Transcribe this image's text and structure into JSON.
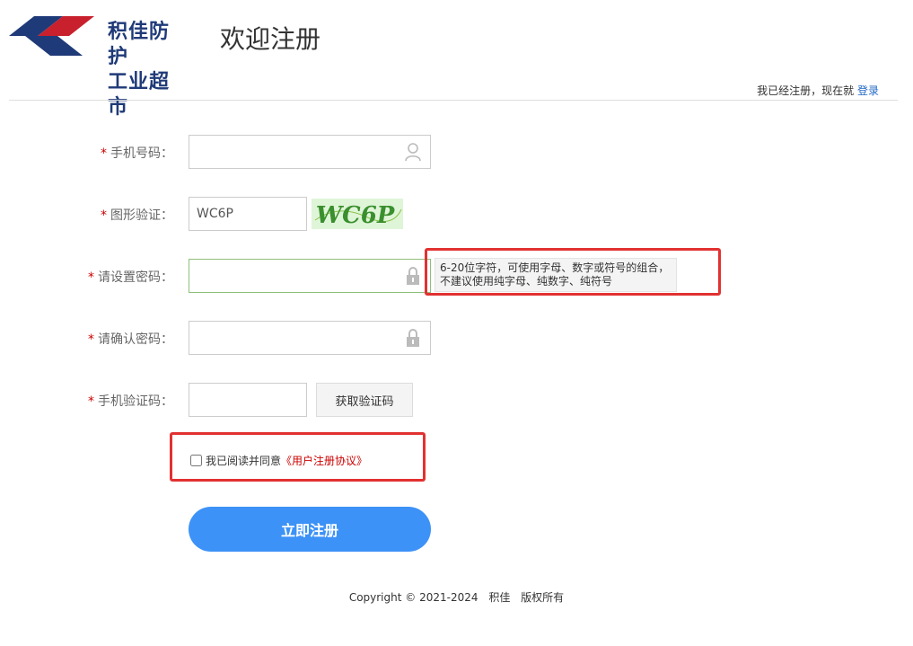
{
  "header": {
    "logo_line1": "积佳防护",
    "logo_line2": "工业超市",
    "page_title": "欢迎注册",
    "login_prompt": "我已经注册，现在就",
    "login_link": "登录"
  },
  "form": {
    "phone": {
      "label": "手机号码：",
      "value": "",
      "icon": "user-icon"
    },
    "captcha": {
      "label": "图形验证：",
      "value": "WC6P",
      "image_text": "WC6P"
    },
    "password": {
      "label": "请设置密码：",
      "value": "",
      "icon": "lock-icon",
      "tip_line1": "6-20位字符，可使用字母、数字或符号的组合，",
      "tip_line2": "不建议使用纯字母、纯数字、纯符号"
    },
    "confirm": {
      "label": "请确认密码：",
      "value": "",
      "icon": "lock-icon"
    },
    "sms": {
      "label": "手机验证码：",
      "value": "",
      "button": "获取验证码"
    },
    "required_mark": "*",
    "agree_prefix": "我已阅读并同意",
    "agree_link": "《用户注册协议》",
    "submit": "立即注册"
  },
  "footer": {
    "copyright": "Copyright © 2021-2024",
    "company": "积佳",
    "rights": "版权所有"
  },
  "colors": {
    "brand_blue": "#1f3a78",
    "brand_red": "#c8202c",
    "submit_blue": "#3d92f7",
    "highlight_red": "#e23131",
    "required_red": "#cc0000"
  }
}
